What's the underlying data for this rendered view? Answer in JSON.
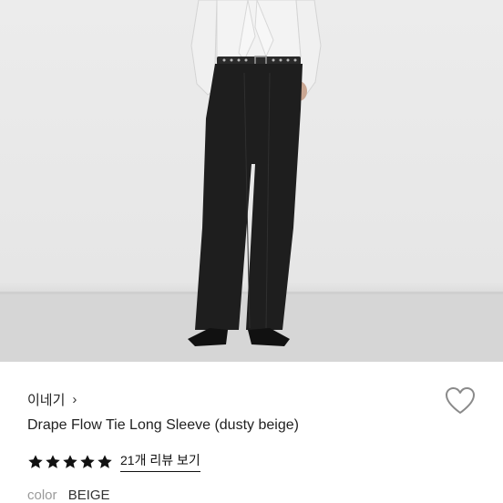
{
  "product": {
    "brand": "이네기",
    "brand_chevron": "›",
    "title": "Drape Flow Tie Long Sleeve (dusty beige)",
    "rating_stars": 5,
    "reviews_link": "21개 리뷰 보기",
    "color_label": "color",
    "color_value": "BEIGE"
  },
  "icons": {
    "wishlist": "heart-outline-icon",
    "star": "star-filled-icon",
    "chevron": "chevron-right-icon"
  },
  "colors": {
    "photo_background": "#e8e8e8",
    "pants": "#1e1e1e",
    "text_primary": "#222222",
    "text_muted": "#9a9a9a"
  }
}
